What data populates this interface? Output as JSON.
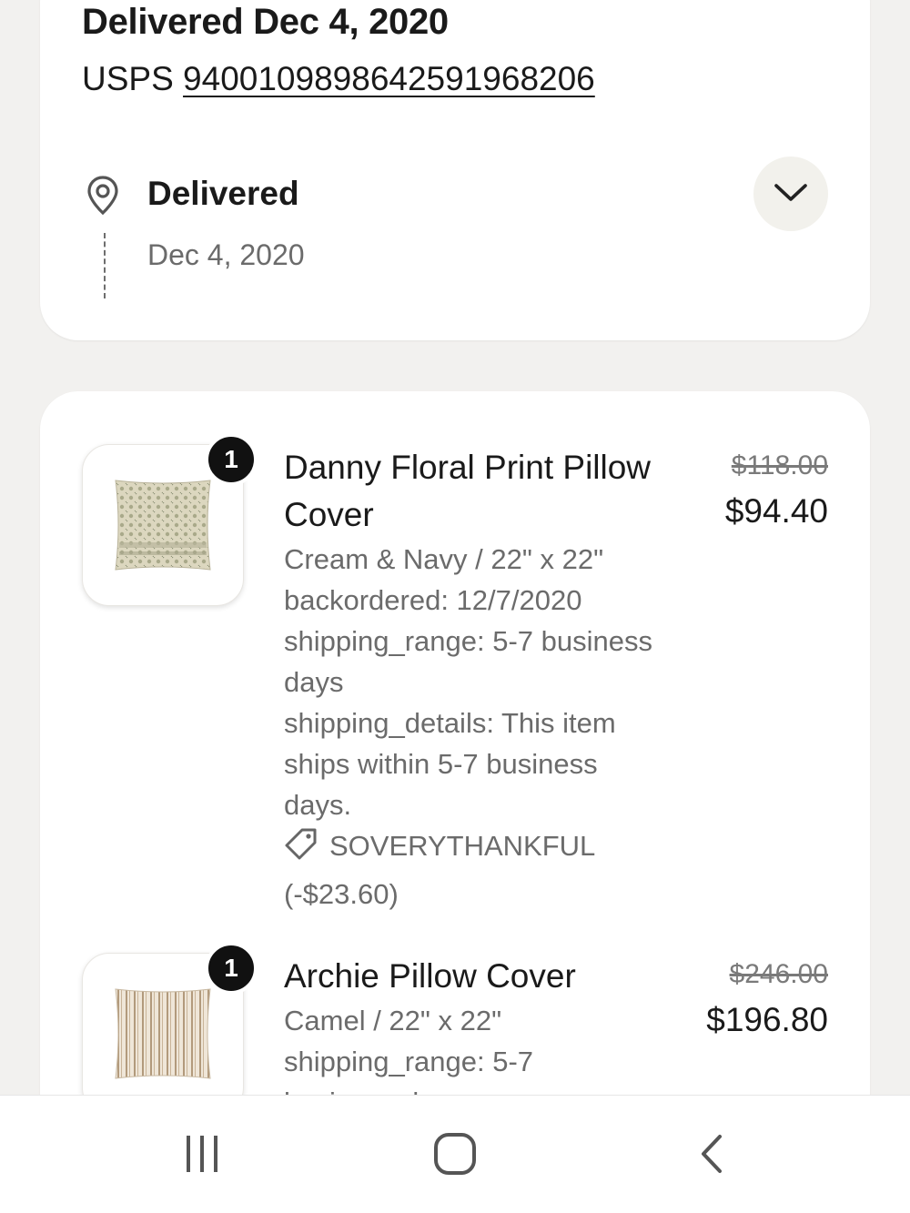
{
  "shipment": {
    "title": "Delivered Dec 4, 2020",
    "carrier": "USPS",
    "tracking_number": "9400109898642591968206",
    "status": "Delivered",
    "status_date": "Dec 4, 2020",
    "expand_icon": "chevron-down-icon",
    "location_icon": "map-pin-icon"
  },
  "items": [
    {
      "quantity": "1",
      "name_line1": "Danny Floral Print Pillow",
      "name_line2": "Cover",
      "variant": "Cream & Navy / 22\" x 22\"",
      "detail_lines": [
        "backordered: 12/7/2020",
        "shipping_range: 5-7 business",
        "days",
        "shipping_details: This item",
        "ships within 5-7 business",
        "days."
      ],
      "promo_icon": "tag-icon",
      "promo_code": "SOVERYTHANKFUL",
      "promo_amount": "(-$23.60)",
      "original_price": "$118.00",
      "price": "$94.40"
    },
    {
      "quantity": "1",
      "name_line1": "Archie Pillow Cover",
      "variant": "Camel / 22\" x 22\"",
      "detail_lines": [
        "shipping_range: 5-7",
        "business days"
      ],
      "original_price": "$246.00",
      "price": "$196.80"
    }
  ],
  "navbar": {
    "recents_icon": "recent-apps-icon",
    "home_icon": "home-icon",
    "back_icon": "back-icon"
  },
  "colors": {
    "background": "#f2f1ef",
    "card": "#ffffff",
    "badge": "#111111",
    "muted_text": "#6b6b6b"
  }
}
